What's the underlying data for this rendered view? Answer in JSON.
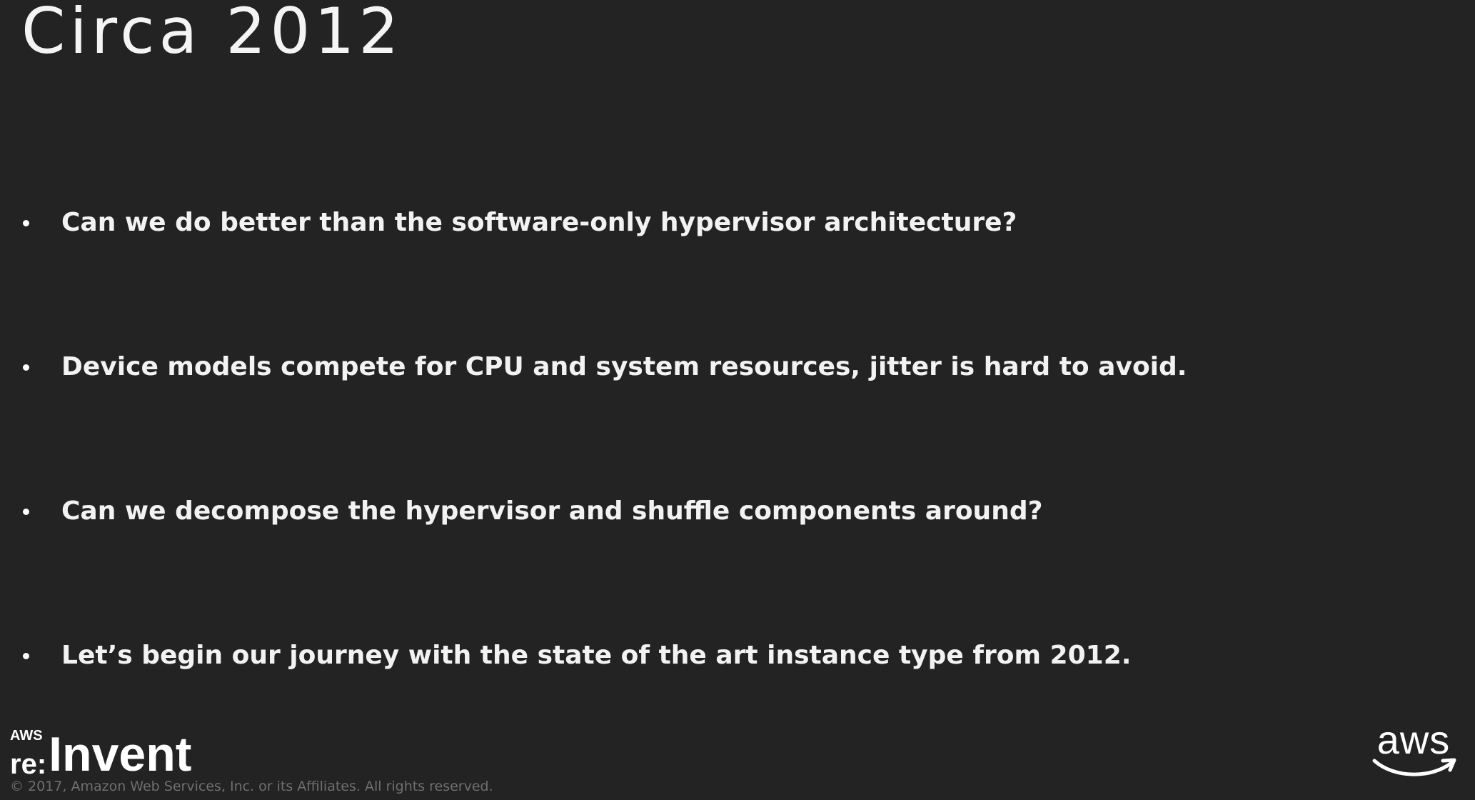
{
  "slide": {
    "title": "Circa 2012",
    "bullets": [
      "Can we do better than the software-only hypervisor architecture?",
      "Device models compete for CPU and system resources, jitter is hard to avoid.",
      "Can we decompose the hypervisor and shuffle components around?",
      "Let’s begin our journey with the state of the art instance type from 2012."
    ]
  },
  "footer": {
    "event_logo": {
      "small": "AWS",
      "prefix": "re:",
      "name": "Invent"
    },
    "copyright": "© 2017, Amazon Web Services, Inc. or its Affiliates. All rights reserved.",
    "brand_logo": "aws"
  },
  "colors": {
    "background": "#232323",
    "text": "#f2f2f2",
    "copyright": "#6f6f6f"
  }
}
